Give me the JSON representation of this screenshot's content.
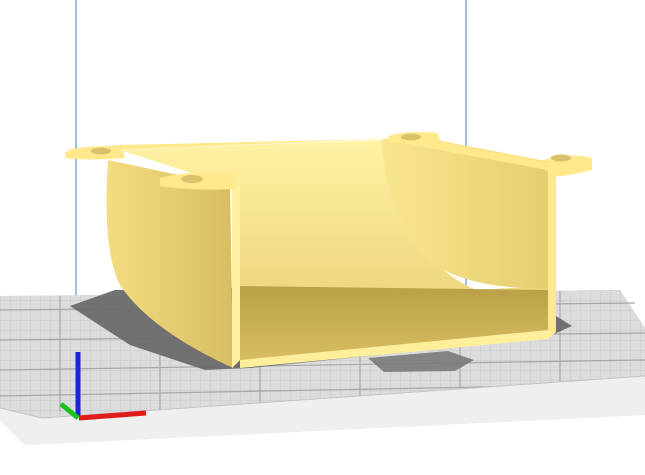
{
  "viewport": {
    "background_color": "#ffffff",
    "build_plate_color": "#e3e3e3",
    "build_plate_edge_color": "#cfcfcf",
    "grid_minor_color": "#c9c9c9",
    "grid_major_color": "#a7a7a7",
    "volume_outline_color": "#2f7fd6",
    "model_color": "#ffe98c",
    "model_shade_color": "#e8cf6c",
    "model_dark_color": "#b79f4e",
    "shadow_color": "#6a6a6a",
    "axis_x_color": "#e21a1a",
    "axis_y_color": "#18c21b",
    "axis_z_color": "#1b22e0"
  },
  "model": {
    "icon": "printer-model-shape",
    "state": "selected"
  }
}
